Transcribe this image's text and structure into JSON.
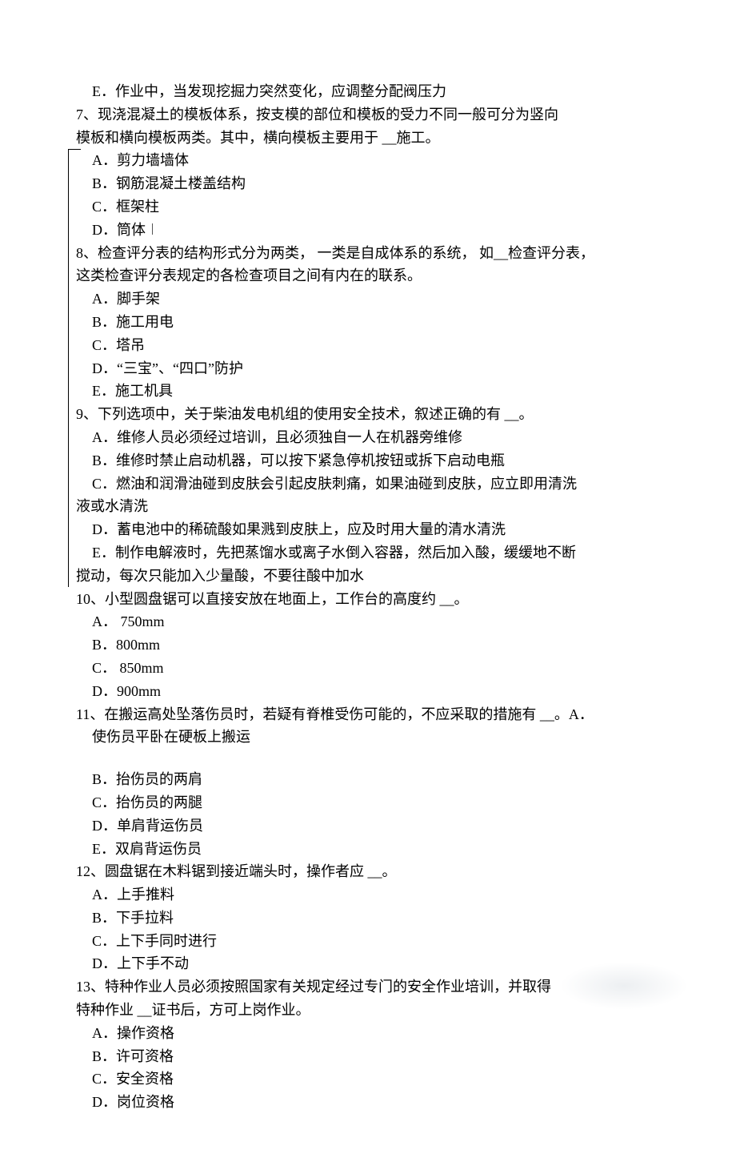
{
  "q6": {
    "optE": "E．作业中，当发现挖掘力突然变化，应调整分配阀压力"
  },
  "q7": {
    "text1": "7、现浇混凝土的模板体系，按支模的部位和模板的受力不同一般可分为竖向",
    "text2": "模板和横向模板两类。其中，横向模板主要用于 __施工。",
    "optA": "A．剪力墙墙体",
    "optB": "B．钢筋混凝土楼盖结构",
    "optC": "C．框架柱",
    "optD": "D．筒体"
  },
  "q8": {
    "text1": "8、检查评分表的结构形式分为两类，  一类是自成体系的系统，  如__检查评分表，",
    "text2": "这类检查评分表规定的各检查项目之间有内在的联系。",
    "optA": "A．脚手架",
    "optB": "B．施工用电",
    "optC": "C．塔吊",
    "optD": "D．“三宝”、“四口”防护",
    "optE": "E．施工机具"
  },
  "q9": {
    "text": "9、下列选项中，关于柴油发电机组的使用安全技术，叙述正确的有     __。",
    "optA": "A．维修人员必须经过培训，且必须独自一人在机器旁维修",
    "optB": "B．维修时禁止启动机器，可以按下紧急停机按钮或拆下启动电瓶",
    "optC1": "C．燃油和润滑油碰到皮肤会引起皮肤刺痛，如果油碰到皮肤，应立即用清洗",
    "optC2": "液或水清洗",
    "optD": "D．蓄电池中的稀硫酸如果溅到皮肤上，应及时用大量的清水清洗",
    "optE1": "E．制作电解液时，先把蒸馏水或离子水倒入容器，然后加入酸，缓缓地不断",
    "optE2": "搅动，每次只能加入少量酸，不要往酸中加水"
  },
  "q10": {
    "text": "10、小型圆盘锯可以直接安放在地面上，工作台的高度约     __。",
    "optA": "A． 750mm",
    "optB": "B．800mm",
    "optC": "C． 850mm",
    "optD": "D．900mm"
  },
  "q11": {
    "text1": "11、在搬运高处坠落伤员时，若疑有脊椎受伤可能的，不应采取的措施有 __。A．",
    "text2": "使伤员平卧在硬板上搬运",
    "optB": "B．抬伤员的两肩",
    "optC": "C．抬伤员的两腿",
    "optD": "D．单肩背运伤员",
    "optE": "E．双肩背运伤员"
  },
  "q12": {
    "text": "12、圆盘锯在木料锯到接近端头时，操作者应    __。",
    "optA": "A．上手推料",
    "optB": "B．下手拉料",
    "optC": "C．上下手同时进行",
    "optD": "D．上下手不动"
  },
  "q13": {
    "text1": "13、特种作业人员必须按照国家有关规定经过专门的安全作业培训，并取得",
    "text2": "特种作业 __证书后，方可上岗作业。",
    "optA": "A．操作资格",
    "optB": "B．许可资格",
    "optC": "C．安全资格",
    "optD": "D．岗位资格"
  }
}
